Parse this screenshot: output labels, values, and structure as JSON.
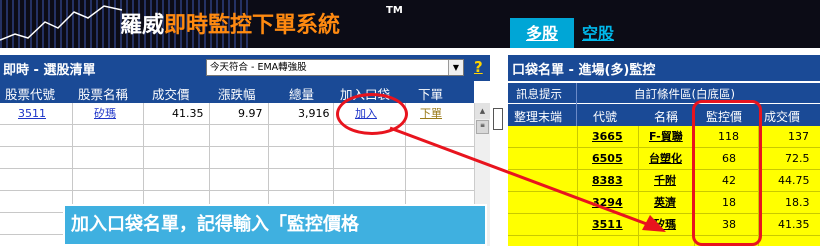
{
  "banner": {
    "brand_prefix": "羅威",
    "brand_suffix": "即時監控下單系統",
    "trademark": "TM",
    "tab_long": "多股",
    "tab_short": "空股"
  },
  "left_panel": {
    "title": "即時 - 選股清單",
    "filter_select": {
      "value": "今天符合 - EMA轉強股"
    },
    "help": "?",
    "columns": [
      "股票代號",
      "股票名稱",
      "成交價",
      "漲跌幅",
      "總量",
      "加入口袋",
      "下單"
    ],
    "rows": [
      {
        "code": "3511",
        "name": "矽瑪",
        "price": "41.35",
        "change": "9.97",
        "volume": "3,916",
        "add": "加入",
        "order": "下單"
      }
    ]
  },
  "right_panel": {
    "title": "口袋名單 - 進場(多)監控",
    "header_group_alert": "訊息提示",
    "header_group_custom": "自訂條件區(白底區)",
    "columns": [
      "整理末端",
      "代號",
      "名稱",
      "監控價",
      "成交價"
    ],
    "rows": [
      {
        "code": "3665",
        "name": "F-貿聯",
        "monitor_price": "118",
        "price": "137"
      },
      {
        "code": "6505",
        "name": "台塑化",
        "monitor_price": "68",
        "price": "72.5"
      },
      {
        "code": "8383",
        "name": "千附",
        "monitor_price": "42",
        "price": "44.75"
      },
      {
        "code": "3294",
        "name": "英濟",
        "monitor_price": "18",
        "price": "18.3"
      },
      {
        "code": "3511",
        "name": "矽瑪",
        "monitor_price": "38",
        "price": "41.35"
      }
    ]
  },
  "annotation": {
    "caption": "加入口袋名單，記得輸入「監控價格",
    "color": "#e8141e"
  },
  "colors": {
    "header_blue": "#1a4a96",
    "highlight_yellow": "#ffff00",
    "brand_orange": "#ff8a10",
    "tab_cyan": "#00a6d6"
  }
}
